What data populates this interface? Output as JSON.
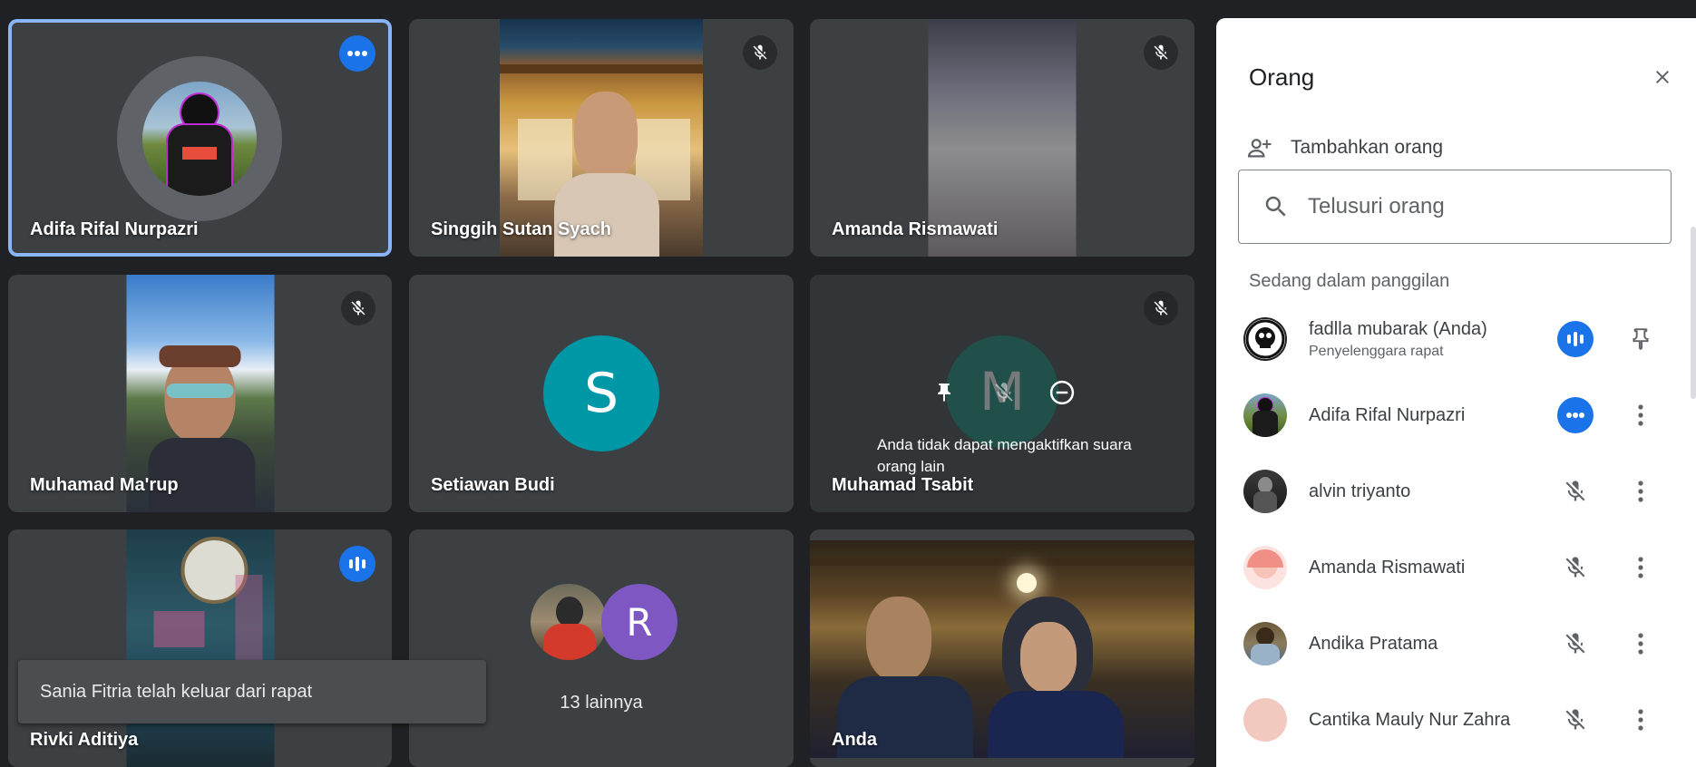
{
  "tiles": [
    {
      "name": "Adifa Rifal Nurpazri"
    },
    {
      "name": "Singgih Sutan Syach"
    },
    {
      "name": "Amanda Rismawati"
    },
    {
      "name": "Muhamad Ma'rup"
    },
    {
      "name": "Setiawan Budi",
      "avatar_letter": "S"
    },
    {
      "name": "Muhamad Tsabit",
      "overlay_message": "Anda tidak dapat mengaktifkan suara orang lain",
      "overlay_letter": "M"
    },
    {
      "name": "Rivki Aditiya"
    },
    {
      "name": "13 lainnya",
      "avatar_letter": "R"
    },
    {
      "name": "Anda"
    }
  ],
  "toast": {
    "message": "Sania Fitria telah keluar dari rapat"
  },
  "panel": {
    "title": "Orang",
    "add_label": "Tambahkan orang",
    "search_placeholder": "Telusuri orang",
    "section_label": "Sedang dalam panggilan",
    "participants": [
      {
        "name": "fadlla mubarak (Anda)",
        "subtitle": "Penyelenggara rapat"
      },
      {
        "name": "Adifa Rifal Nurpazri"
      },
      {
        "name": "alvin triyanto"
      },
      {
        "name": "Amanda Rismawati"
      },
      {
        "name": "Andika Pratama"
      },
      {
        "name": "Cantika Mauly Nur Zahra"
      }
    ]
  },
  "colors": {
    "accent": "#1a73e8",
    "active_border": "#8ab4f8",
    "tile_bg": "#3c4043",
    "page_bg": "#202124",
    "avatar_teal": "#0097a7",
    "avatar_purple": "#7e57c2",
    "avatar_green": "#0f8a74"
  }
}
